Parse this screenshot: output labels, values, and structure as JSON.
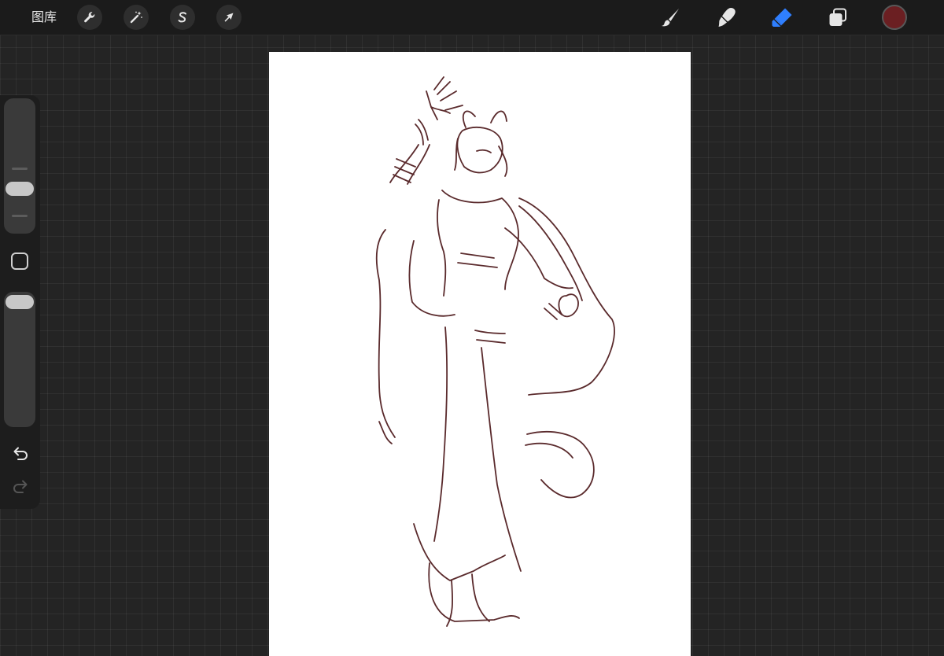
{
  "top_bar": {
    "gallery_label": "图库",
    "left_tools": [
      {
        "name": "actions",
        "icon": "wrench-icon"
      },
      {
        "name": "adjustments",
        "icon": "magic-wand-icon"
      },
      {
        "name": "selection",
        "icon": "selection-s-icon"
      },
      {
        "name": "transform",
        "icon": "arrow-cursor-icon"
      }
    ],
    "right_tools": [
      {
        "name": "brush",
        "icon": "brush-icon",
        "active": false
      },
      {
        "name": "smudge",
        "icon": "smudge-icon",
        "active": false
      },
      {
        "name": "eraser",
        "icon": "eraser-icon",
        "active": true
      },
      {
        "name": "layers",
        "icon": "layers-icon",
        "active": false
      }
    ],
    "current_color": "#6b1f22"
  },
  "sidebar": {
    "brush_size_level": 0.3,
    "opacity_level": 1.0,
    "undo_enabled": true,
    "redo_enabled": false
  },
  "colors": {
    "accent": "#2f7fff",
    "sketch_stroke": "#5a2a2c",
    "inactive_icon": "#e6e6e6"
  }
}
